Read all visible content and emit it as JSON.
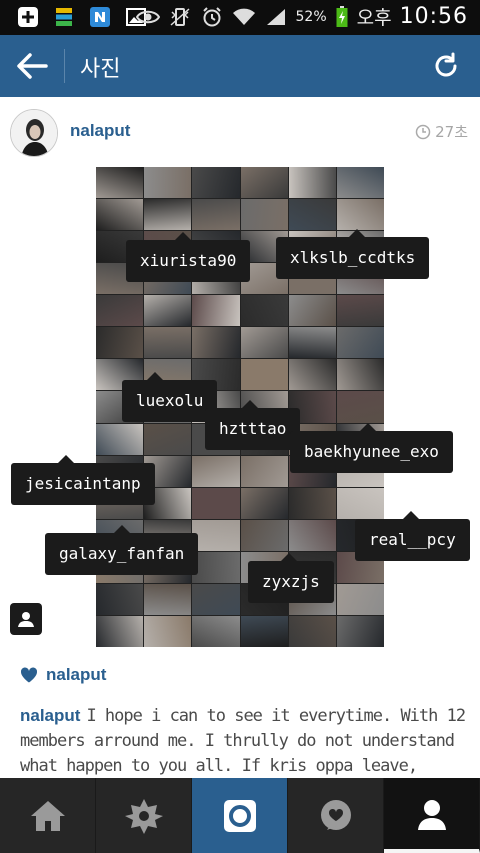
{
  "status_bar": {
    "battery_percent": "52%",
    "ampm": "오후",
    "time": "10:56",
    "icons": [
      "add-icon",
      "stack-icon",
      "naver-icon",
      "image-icon",
      "eye-icon",
      "vibrate-icon",
      "alarm-icon",
      "wifi-icon",
      "signal-icon",
      "battery-icon"
    ]
  },
  "action_bar": {
    "title": "사진",
    "back_icon": "arrow-left-icon",
    "refresh_icon": "refresh-icon"
  },
  "post": {
    "username": "nalaput",
    "time_ago": "27초",
    "tags": [
      "xiurista90",
      "xlkslb_ccdtks",
      "luexolu",
      "hztttao",
      "baekhyunee_exo",
      "jesicaintanp",
      "real__pcy",
      "galaxy_fanfan",
      "zyxzjs"
    ],
    "likes_user": "nalaput",
    "caption_user": "nalaput",
    "caption_text": "I hope i can to see it everytime. With 12 members arround me. I thrully do not understand what happen to you all. If kris oppa leave, there is"
  },
  "tab_bar": {
    "tabs": [
      "home-icon",
      "explore-icon",
      "camera-icon",
      "news-icon",
      "profile-icon"
    ]
  },
  "colors": {
    "accent": "#2a5f8f",
    "tab_bar": "#262626",
    "tag_bg": "#1b1b1b"
  }
}
